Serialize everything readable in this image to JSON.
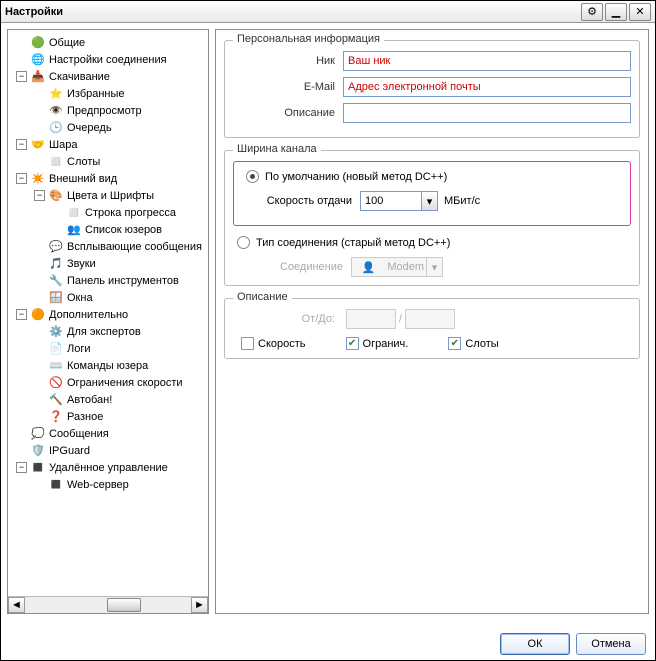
{
  "title": "Настройки",
  "tree": [
    {
      "ind": 0,
      "exp": "",
      "icon": "🟢",
      "label": "Общие"
    },
    {
      "ind": 0,
      "exp": "",
      "icon": "🌐",
      "label": "Настройки соединения"
    },
    {
      "ind": 0,
      "exp": "−",
      "icon": "📥",
      "label": "Скачивание"
    },
    {
      "ind": 1,
      "exp": "",
      "icon": "⭐",
      "label": "Избранные"
    },
    {
      "ind": 1,
      "exp": "",
      "icon": "👁️",
      "label": "Предпросмотр"
    },
    {
      "ind": 1,
      "exp": "",
      "icon": "🕒",
      "label": "Очередь"
    },
    {
      "ind": 0,
      "exp": "−",
      "icon": "🤝",
      "label": "Шара"
    },
    {
      "ind": 1,
      "exp": "",
      "icon": "◻️",
      "label": "Слоты"
    },
    {
      "ind": 0,
      "exp": "−",
      "icon": "✴️",
      "label": "Внешний вид"
    },
    {
      "ind": 1,
      "exp": "−",
      "icon": "🎨",
      "label": "Цвета и Шрифты"
    },
    {
      "ind": 2,
      "exp": "",
      "icon": "◻️",
      "label": "Строка прогресса"
    },
    {
      "ind": 2,
      "exp": "",
      "icon": "👥",
      "label": "Список юзеров"
    },
    {
      "ind": 1,
      "exp": "",
      "icon": "💬",
      "label": "Всплывающие сообщения"
    },
    {
      "ind": 1,
      "exp": "",
      "icon": "🎵",
      "label": "Звуки"
    },
    {
      "ind": 1,
      "exp": "",
      "icon": "🔧",
      "label": "Панель инструментов"
    },
    {
      "ind": 1,
      "exp": "",
      "icon": "🪟",
      "label": "Окна"
    },
    {
      "ind": 0,
      "exp": "−",
      "icon": "🟠",
      "label": "Дополнительно"
    },
    {
      "ind": 1,
      "exp": "",
      "icon": "⚙️",
      "label": "Для экспертов"
    },
    {
      "ind": 1,
      "exp": "",
      "icon": "📄",
      "label": "Логи"
    },
    {
      "ind": 1,
      "exp": "",
      "icon": "⌨️",
      "label": "Команды юзера"
    },
    {
      "ind": 1,
      "exp": "",
      "icon": "🚫",
      "label": "Ограничения скорости"
    },
    {
      "ind": 1,
      "exp": "",
      "icon": "🔨",
      "label": "Автобан!"
    },
    {
      "ind": 1,
      "exp": "",
      "icon": "❓",
      "label": "Разное"
    },
    {
      "ind": 0,
      "exp": "",
      "icon": "💭",
      "label": "Сообщения"
    },
    {
      "ind": 0,
      "exp": "",
      "icon": "🛡️",
      "label": "IPGuard"
    },
    {
      "ind": 0,
      "exp": "−",
      "icon": "◼️",
      "label": "Удалённое управление"
    },
    {
      "ind": 1,
      "exp": "",
      "icon": "◼️",
      "label": "Web-сервер"
    }
  ],
  "personal": {
    "legend": "Персональная информация",
    "nick_label": "Ник",
    "nick_value": "Ваш ник",
    "email_label": "E-Mail",
    "email_value": "Адрес электронной почты",
    "desc_label": "Описание",
    "desc_value": ""
  },
  "bandwidth": {
    "legend": "Ширина канала",
    "opt1": "По умолчанию (новый метод DC++)",
    "speed_label": "Скорость отдачи",
    "speed_value": "100",
    "speed_unit": "МБит/с",
    "opt2": "Тип соединения (старый метод DC++)",
    "conn_label": "Соединение",
    "conn_value": "Modem"
  },
  "desc": {
    "legend": "Описание",
    "fromto": "От/До:",
    "slash": "/",
    "speed": "Скорость",
    "limit": "Огранич.",
    "slots": "Слоты"
  },
  "buttons": {
    "ok": "ОК",
    "cancel": "Отмена"
  }
}
